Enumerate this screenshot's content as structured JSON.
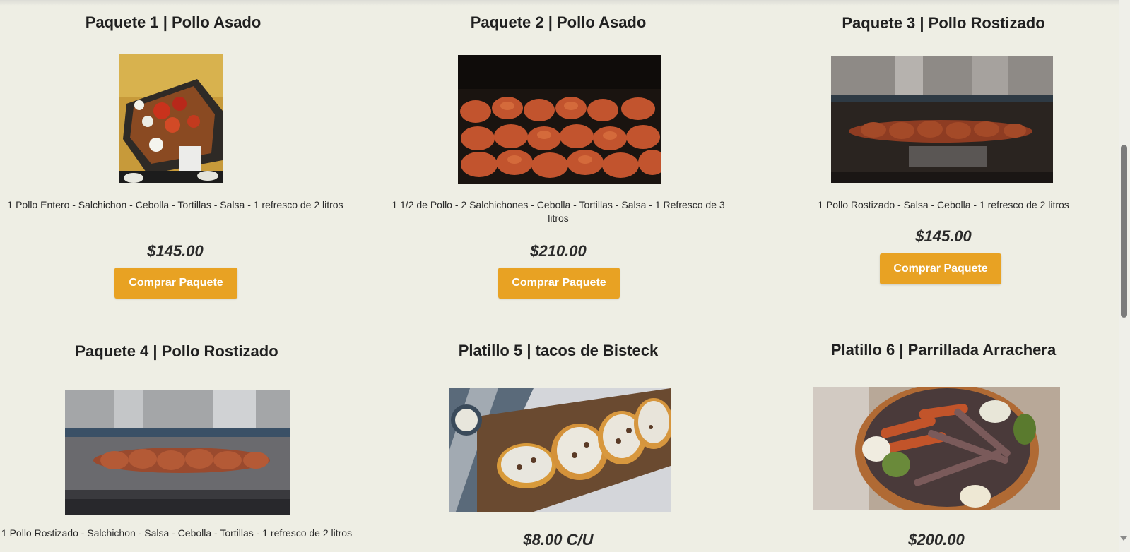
{
  "products": [
    {
      "title": "Paquete 1 | Pollo Asado",
      "image_icon": "grilled-chicken-tray-photo",
      "description": "1 Pollo Entero - Salchichon - Cebolla - Tortillas - Salsa - 1 refresco de 2 litros",
      "price": "$145.00",
      "button": "Comprar Paquete"
    },
    {
      "title": "Paquete 2 | Pollo Asado",
      "image_icon": "grilled-chicken-rows-photo",
      "description": "1 1/2 de Pollo - 2 Salchichones - Cebolla - Tortillas - Salsa - 1 Refresco de 3 litros",
      "price": "$210.00",
      "button": "Comprar Paquete"
    },
    {
      "title": "Paquete 3 | Pollo Rostizado",
      "image_icon": "rotisserie-chicken-photo",
      "description": "1 Pollo Rostizado - Salsa - Cebolla - 1 refresco de 2 litros",
      "price": "$145.00",
      "button": "Comprar Paquete"
    },
    {
      "title": "Paquete 4 | Pollo Rostizado",
      "image_icon": "rotisserie-chicken-photo",
      "description": "1 Pollo Rostizado - Salchichon - Salsa - Cebolla - Tortillas - 1 refresco de 2 litros"
    },
    {
      "title": "Platillo 5 | tacos de Bisteck",
      "image_icon": "steak-tacos-photo",
      "price": "$8.00 C/U"
    },
    {
      "title": "Platillo 6 | Parrillada Arrachera",
      "image_icon": "arrachera-grill-platter-photo",
      "price": "$200.00"
    }
  ],
  "colors": {
    "background": "#eeeee4",
    "button": "#e8a223",
    "button_text": "#ffffff",
    "text": "#1e1e1e"
  }
}
